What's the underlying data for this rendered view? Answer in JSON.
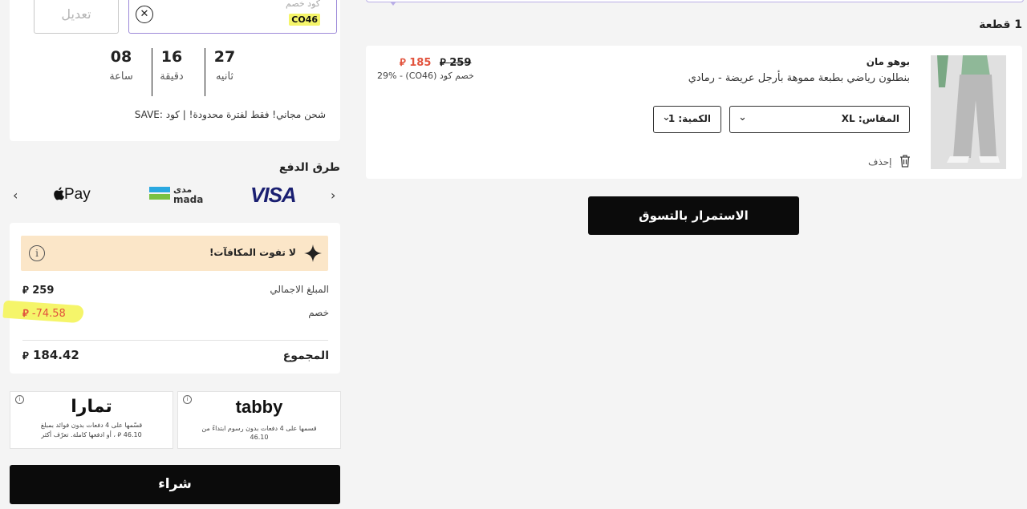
{
  "coupon": {
    "label": "كود خصم",
    "code": "CO46",
    "edit_label": "تعديل",
    "clear_symbol": "✕"
  },
  "timer": {
    "hours": {
      "value": "08",
      "unit": "ساعة"
    },
    "minutes": {
      "value": "16",
      "unit": "دقيقة"
    },
    "seconds": {
      "value": "27",
      "unit": "ثانيه"
    }
  },
  "promo_text": "شحن مجاني! فقط لفترة محدودة! | كود :SAVE",
  "payment": {
    "title": "طرق الدفع",
    "methods": [
      "VISA",
      "مدى",
      "mada",
      "Pay"
    ],
    "prev_icon": "‹",
    "next_icon": "›"
  },
  "summary": {
    "rewards_text": "لا تفوت المكافآت!",
    "info_icon": "i",
    "subtotal_label": "المبلغ الاجمالي",
    "subtotal_value": "259",
    "discount_label": "خصم",
    "discount_value": "-74.58",
    "total_label": "المجموع",
    "total_value": "184.42",
    "currency_symbol": "⃁"
  },
  "bnpl": {
    "tabby": {
      "logo": "tabby",
      "desc_line1": "قسمها على 4 دفعات بدون رسوم ابتداءً من",
      "desc_line2": "46.10"
    },
    "tamara": {
      "logo": "تمارا",
      "desc_line1": "قسّمها على 4 دفعات بدون فوائد بمبلغ",
      "desc_line2": "46.10 ⃁ ، أو ادفعها كاملة. تعرّف أكثر"
    }
  },
  "buy_label": "شراء",
  "cart": {
    "count_label": "1 قطعة",
    "item": {
      "brand": "بوهو مان",
      "name": "بنطلون رياضي بطبعة مموهة بأرجل عريضة - رمادي",
      "price_new": "185",
      "price_old": "259",
      "discount_note": "خصم كود (CO46) - 29%",
      "size_label": "المقاس: XL",
      "qty_label": "الكمية: 1",
      "delete_label": "إحذف"
    },
    "continue_label": "الاستمرار بالتسوق"
  },
  "colors": {
    "accent_purple": "#9d8ad9",
    "sale_red": "#e2533d",
    "highlight_yellow": "#f5f56a",
    "rewards_bg": "#fbe6c8",
    "button_black": "#0b0b0b"
  }
}
